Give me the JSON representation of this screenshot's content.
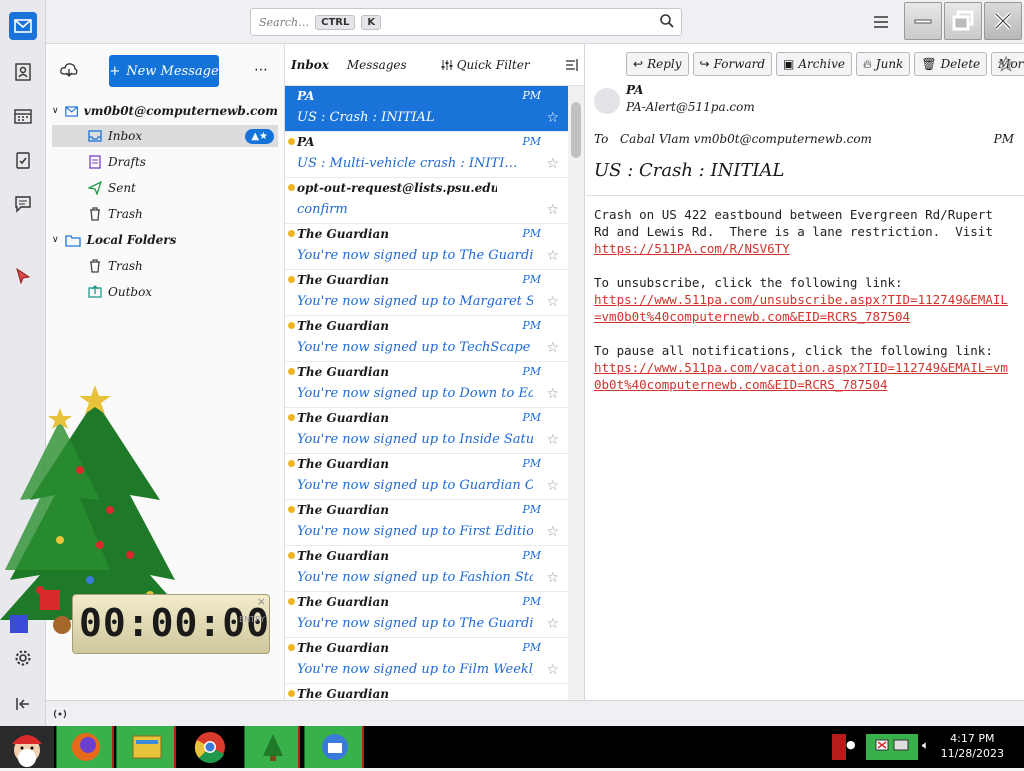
{
  "search": {
    "placeholder": "Search…",
    "kbd1": "CTRL",
    "kbd2": "K"
  },
  "folder_pane": {
    "new_message": "New Message",
    "account": "vm0b0t@computernewb.com",
    "folders": [
      {
        "label": "Inbox",
        "badge": ""
      },
      {
        "label": "Drafts"
      },
      {
        "label": "Sent"
      },
      {
        "label": "Trash"
      }
    ],
    "local_label": "Local Folders",
    "local_folders": [
      {
        "label": "Trash"
      },
      {
        "label": "Outbox"
      }
    ]
  },
  "clock": {
    "digits": "00:00:00",
    "label": "ENTRY"
  },
  "list_header": {
    "folder": "Inbox",
    "count_label": "Messages",
    "quick_filter": "Quick Filter"
  },
  "messages": [
    {
      "sender": "PA",
      "subject": "US : Crash : INITIAL",
      "date": "PM",
      "unread": false,
      "selected": true
    },
    {
      "sender": "PA",
      "subject": "US : Multi-vehicle crash : INITI…",
      "date": "PM",
      "unread": true,
      "selected": false
    },
    {
      "sender": "opt-out-request@lists.psu.edu",
      "subject": "confirm",
      "date": "",
      "unread": true,
      "selected": false
    },
    {
      "sender": "The Guardian",
      "subject": "You're now signed up to The Guardian Ne…",
      "date": "PM",
      "unread": true,
      "selected": false
    },
    {
      "sender": "The Guardian",
      "subject": "You're now signed up to Margaret Sullivan's…",
      "date": "PM",
      "unread": true,
      "selected": false
    },
    {
      "sender": "The Guardian",
      "subject": "You're now signed up to TechScape",
      "date": "PM",
      "unread": true,
      "selected": false
    },
    {
      "sender": "The Guardian",
      "subject": "You're now signed up to Down to Earth",
      "date": "PM",
      "unread": true,
      "selected": false
    },
    {
      "sender": "The Guardian",
      "subject": "You're now signed up to Inside Saturday",
      "date": "PM",
      "unread": true,
      "selected": false
    },
    {
      "sender": "The Guardian",
      "subject": "You're now signed up to Guardian Opinion …",
      "date": "PM",
      "unread": true,
      "selected": false
    },
    {
      "sender": "The Guardian",
      "subject": "You're now signed up to First Edition",
      "date": "PM",
      "unread": true,
      "selected": false
    },
    {
      "sender": "The Guardian",
      "subject": "You're now signed up to Fashion Statement",
      "date": "PM",
      "unread": true,
      "selected": false
    },
    {
      "sender": "The Guardian",
      "subject": "You're now signed up to The Guardian Hea…",
      "date": "PM",
      "unread": true,
      "selected": false
    },
    {
      "sender": "The Guardian",
      "subject": "You're now signed up to Film Weekly",
      "date": "PM",
      "unread": true,
      "selected": false
    },
    {
      "sender": "The Guardian",
      "subject": "",
      "date": "",
      "unread": true,
      "selected": false
    }
  ],
  "actions": [
    "Reply",
    "Forward",
    "Archive",
    "Junk",
    "Delete",
    "More"
  ],
  "reader": {
    "from_name": "PA",
    "from_addr": "PA-Alert@511pa.com",
    "to_label": "To",
    "to_value": "Cabal Vlam vm0b0t@computernewb.com",
    "date": "PM",
    "subject": "US : Crash : INITIAL",
    "body_intro": "Crash on US 422 eastbound between Evergreen Rd/Rupert Rd and Lewis Rd.  There is a lane restriction.  Visit ",
    "link1": "https://511PA.com/R/NSV6TY",
    "unsub_text": "To unsubscribe, click the following link:",
    "link2": "https://www.511pa.com/unsubscribe.aspx?TID=112749&EMAIL=vm0b0t%40computernewb.com&EID=RCRS_787504",
    "pause_text": "To pause all notifications, click the following link:",
    "link3": "https://www.511pa.com/vacation.aspx?TID=112749&EMAIL=vm0b0t%40computernewb.com&EID=RCRS_787504"
  },
  "taskbar": {
    "time": "4:17 PM",
    "date": "11/28/2023"
  },
  "colors": {
    "accent": "#1373d9",
    "link": "#d0342c",
    "taskbar_button": "#39b14a"
  }
}
